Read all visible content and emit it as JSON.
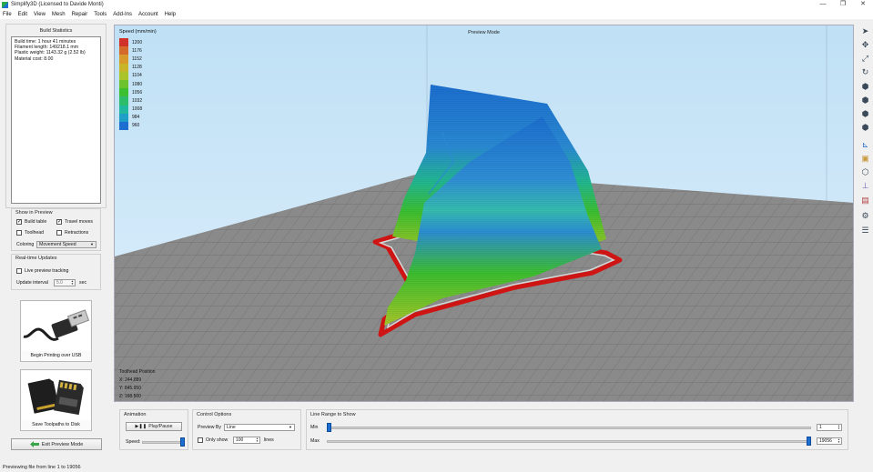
{
  "window": {
    "title": "Simplify3D (Licensed to Davide Monti)",
    "minimize": "—",
    "maximize": "❐",
    "close": "✕"
  },
  "menu": [
    "File",
    "Edit",
    "View",
    "Mesh",
    "Repair",
    "Tools",
    "Add-Ins",
    "Account",
    "Help"
  ],
  "build_stats": {
    "title": "Build Statistics",
    "lines": [
      "Build time: 1 hour 41 minutes",
      "Filament length: 149218.1 mm",
      "Plastic weight: 1143.32 g (2.52 lb)",
      "Material cost: 8.00"
    ]
  },
  "show_in_preview": {
    "title": "Show in Preview",
    "build_table": "Build table",
    "travel_moves": "Travel moves",
    "toolhead": "Toolhead",
    "retractions": "Retractions",
    "coloring_label": "Coloring",
    "coloring_value": "Movement Speed"
  },
  "realtime": {
    "title": "Real-time Updates",
    "live_tracking": "Live preview tracking",
    "interval_label": "Update interval",
    "interval_value": "5.0",
    "interval_unit": "sec"
  },
  "print_usb": {
    "label": "Begin Printing over USB",
    "icon": "usb-cable-icon"
  },
  "save_disk": {
    "label": "Save Toolpaths to Disk",
    "icon": "sd-card-icon"
  },
  "exit_preview": {
    "label": "Exit Preview Mode",
    "icon": "back-arrow-icon"
  },
  "viewport": {
    "mode_label": "Preview Mode",
    "legend_title": "Speed (mm/min)",
    "legend": [
      {
        "label": "1200",
        "color": "#d2312a"
      },
      {
        "label": "1176",
        "color": "#d46a2a"
      },
      {
        "label": "1152",
        "color": "#d89a2a"
      },
      {
        "label": "1128",
        "color": "#c8b52a"
      },
      {
        "label": "1104",
        "color": "#a8c42a"
      },
      {
        "label": "1080",
        "color": "#6cc22a"
      },
      {
        "label": "1056",
        "color": "#3cbf30"
      },
      {
        "label": "1032",
        "color": "#2ebd6a"
      },
      {
        "label": "1008",
        "color": "#22b8a0"
      },
      {
        "label": "984",
        "color": "#1f9fc8"
      },
      {
        "label": "960",
        "color": "#1c6fd0"
      }
    ],
    "toolhead_title": "Toolhead Position",
    "toolhead_x": "X: 244.889",
    "toolhead_y": "Y: 845.950",
    "toolhead_z": "Z: 168.500"
  },
  "right_toolbar": [
    "select-arrow-icon",
    "move-icon",
    "scale-icon",
    "rotate-icon",
    "view-iso-icon",
    "view-front-icon",
    "view-top-icon",
    "view-side-icon",
    "axes-icon",
    "cube-icon",
    "wireframe-cube-icon",
    "cross-section-icon",
    "tool-icon",
    "settings-gear-icon",
    "layers-icon"
  ],
  "animation": {
    "title": "Animation",
    "play_pause": "Play/Pause",
    "speed_label": "Speed:",
    "speed_fraction": 0.95
  },
  "control_options": {
    "title": "Control Options",
    "preview_by_label": "Preview By",
    "preview_by_value": "Line",
    "only_show_label": "Only show",
    "only_show_value": "100",
    "only_show_unit": "lines"
  },
  "line_range": {
    "title": "Line Range to Show",
    "min_label": "Min",
    "max_label": "Max",
    "min_value": "1",
    "max_value": "19056",
    "min_fraction": 0.0,
    "max_fraction": 1.0
  },
  "status_text": "Previewing file from line 1 to 19056"
}
